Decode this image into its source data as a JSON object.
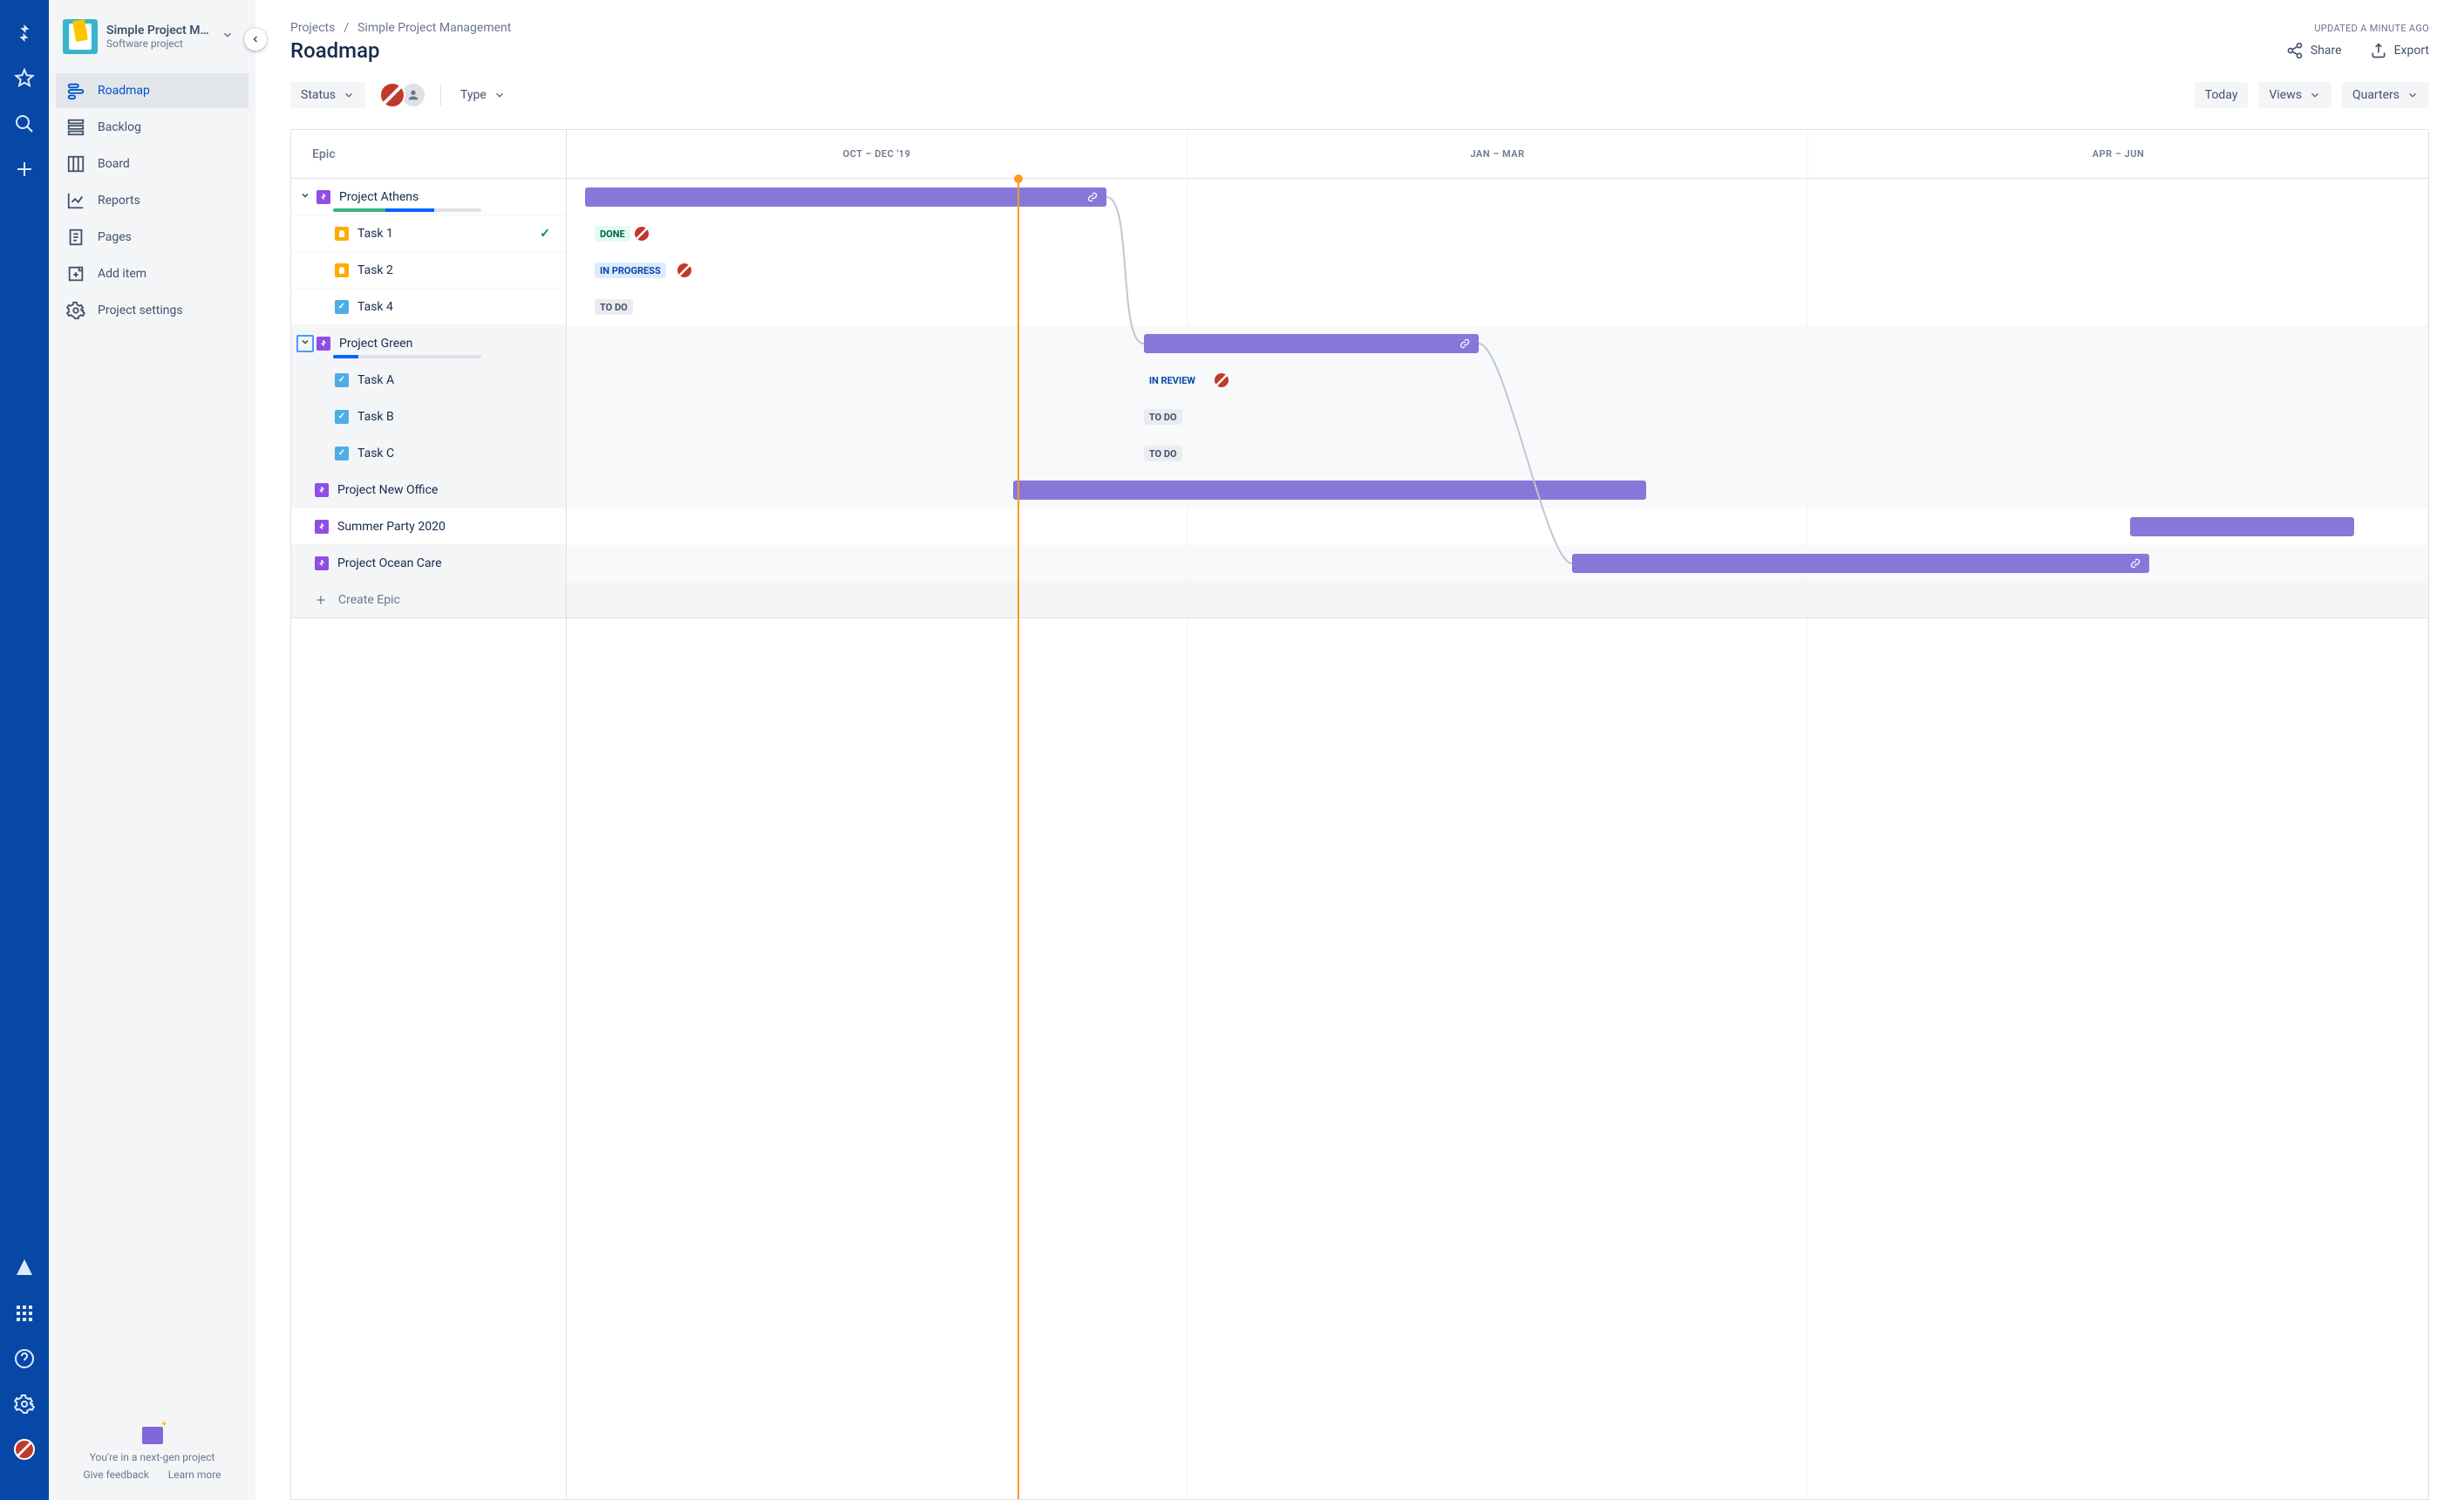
{
  "project": {
    "name": "Simple Project M...",
    "full_name": "Simple Project Management",
    "subtitle": "Software project"
  },
  "sidebar": {
    "items": [
      {
        "label": "Roadmap",
        "active": true
      },
      {
        "label": "Backlog"
      },
      {
        "label": "Board"
      },
      {
        "label": "Reports"
      },
      {
        "label": "Pages"
      },
      {
        "label": "Add item"
      },
      {
        "label": "Project settings"
      }
    ],
    "footer_text": "You're in a next-gen project",
    "feedback": "Give feedback",
    "learn_more": "Learn more"
  },
  "breadcrumbs": {
    "projects": "Projects",
    "current": "Simple Project Management",
    "updated": "UPDATED A MINUTE AGO"
  },
  "page": {
    "title": "Roadmap"
  },
  "actions": {
    "share": "Share",
    "export": "Export"
  },
  "toolbar": {
    "status": "Status",
    "type": "Type",
    "today": "Today",
    "views": "Views",
    "quarters": "Quarters"
  },
  "columns": {
    "epic_header": "Epic"
  },
  "timeline": {
    "headers": [
      "OCT – DEC '19",
      "JAN – MAR",
      "APR – JUN"
    ],
    "today_position_pct": 24.2
  },
  "epics": [
    {
      "name": "Project Athens",
      "expanded": true,
      "progress": {
        "green": 35,
        "blue": 33
      },
      "bar": {
        "start_pct": 1,
        "end_pct": 29,
        "link": true
      },
      "tasks": [
        {
          "name": "Task 1",
          "icon": "idea",
          "status": "DONE",
          "status_class": "st-done",
          "check": true,
          "assignee": true,
          "status_left_pct": 1.5
        },
        {
          "name": "Task 2",
          "icon": "idea",
          "status": "IN PROGRESS",
          "status_class": "st-progress",
          "assignee": true,
          "status_left_pct": 1.5
        },
        {
          "name": "Task 4",
          "icon": "task",
          "status": "TO DO",
          "status_class": "st-todo",
          "status_left_pct": 1.5
        }
      ]
    },
    {
      "name": "Project Green",
      "expanded": true,
      "highlighted": true,
      "bg_grey": true,
      "progress": {
        "green": 0,
        "blue": 17
      },
      "bar": {
        "start_pct": 31,
        "end_pct": 49,
        "link": true
      },
      "tasks": [
        {
          "name": "Task A",
          "icon": "task",
          "status": "IN REVIEW",
          "status_class": "st-review",
          "assignee": true,
          "status_left_pct": 31,
          "bg_grey": true
        },
        {
          "name": "Task B",
          "icon": "task",
          "status": "TO DO",
          "status_class": "st-todo",
          "status_left_pct": 31,
          "bg_grey": true
        },
        {
          "name": "Task C",
          "icon": "task",
          "status": "TO DO",
          "status_class": "st-todo",
          "status_left_pct": 31,
          "bg_grey": true
        }
      ]
    },
    {
      "name": "Project New Office",
      "bar": {
        "start_pct": 24,
        "end_pct": 58
      },
      "bg_grey": true
    },
    {
      "name": "Summer Party 2020",
      "bar": {
        "start_pct": 84,
        "end_pct": 96
      }
    },
    {
      "name": "Project Ocean Care",
      "bar": {
        "start_pct": 54,
        "end_pct": 85,
        "link": true
      },
      "bg_grey": true
    }
  ],
  "create_epic": "Create Epic"
}
